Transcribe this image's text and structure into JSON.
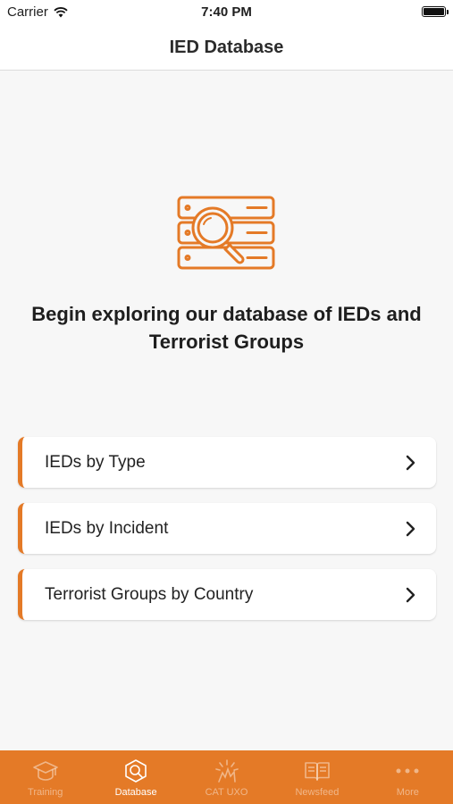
{
  "status_bar": {
    "carrier": "Carrier",
    "time": "7:40 PM"
  },
  "nav": {
    "title": "IED Database"
  },
  "hero": {
    "icon": "database-search-icon",
    "heading": "Begin exploring our database of IEDs and Terrorist Groups"
  },
  "menu": [
    {
      "label": "IEDs by Type"
    },
    {
      "label": "IEDs by Incident"
    },
    {
      "label": "Terrorist Groups by Country"
    }
  ],
  "tabs": [
    {
      "label": "Training",
      "icon": "graduation-cap-icon",
      "active": false
    },
    {
      "label": "Database",
      "icon": "database-icon",
      "active": true
    },
    {
      "label": "CAT UXO",
      "icon": "explosion-icon",
      "active": false
    },
    {
      "label": "Newsfeed",
      "icon": "book-icon",
      "active": false
    },
    {
      "label": "More",
      "icon": "more-dots-icon",
      "active": false
    }
  ],
  "colors": {
    "accent": "#e47a27",
    "background": "#f7f7f7"
  }
}
